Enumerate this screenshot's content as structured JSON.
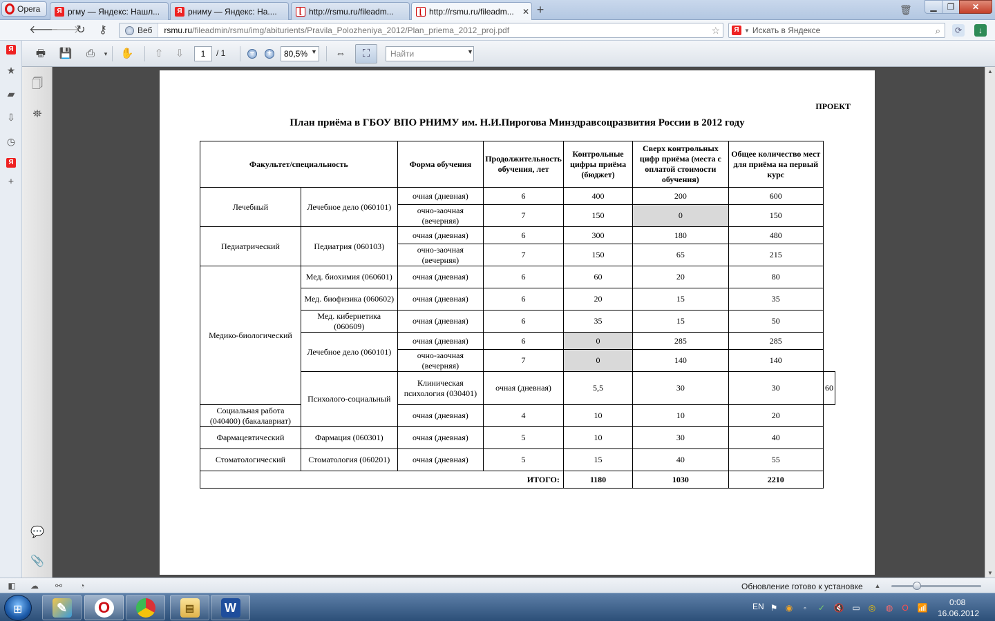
{
  "browser": {
    "menu_label": "Opera",
    "tabs": [
      {
        "title": "ргму — Яндекс: Нашл...",
        "icon": "yandex-icon"
      },
      {
        "title": "рниму — Яндекс: На....",
        "icon": "yandex-icon"
      },
      {
        "title": "http://rsmu.ru/fileadm...",
        "icon": "pdf-icon"
      },
      {
        "title": "http://rsmu.ru/fileadm...",
        "icon": "pdf-icon"
      }
    ],
    "new_tab": "+",
    "address": {
      "mode_label": "Веб",
      "url_domain": "rsmu.ru",
      "url_path": "/fileadmin/rsmu/img/abiturients/Pravila_Polozheniya_2012/Plan_priema_2012_proj.pdf"
    },
    "search": {
      "engine_badge": "Я",
      "placeholder": "Искать в Яндексе"
    }
  },
  "pdf_toolbar": {
    "page_current": "1",
    "page_total": "/ 1",
    "zoom": "80,5%",
    "find_placeholder": "Найти"
  },
  "document": {
    "stamp": "ПРОЕКТ",
    "title": "План приёма в ГБОУ ВПО РНИМУ им. Н.И.Пирогова Минздравсоцразвития России в 2012 году",
    "headers": {
      "faculty": "Факультет/специальность",
      "form": "Форма обучения",
      "duration": "Продолжительность обучения, лет",
      "budget": "Контрольные цифры приёма (бюджет)",
      "paid": "Сверх контрольных цифр приёма (места с оплатой стоимости обучения)",
      "total": "Общее количество мест для приёма на первый курс"
    },
    "faculties": {
      "lech": "Лечебный",
      "ped": "Педиатрический",
      "medbio": "Медико-биологический",
      "psy": "Психолого-социальный",
      "farm": "Фармацевтический",
      "stom": "Стоматологический"
    },
    "specialties": {
      "lech_delo": "Лечебное дело (060101)",
      "pediatriya": "Педиатрия (060103)",
      "biochem": "Мед. биохимия (060601)",
      "biophys": "Мед. биофизика (060602)",
      "cyber": "Мед. кибернетика (060609)",
      "lech_delo2": "Лечебное дело (060101)",
      "clinpsy": "Клиническая психология (030401)",
      "social": "Социальная работа (040400) (бакалавриат)",
      "farmaciya": "Фармация (060301)",
      "stomat": "Стоматология (060201)"
    },
    "forms": {
      "day": "очная (дневная)",
      "evening": "очно-заочная (вечерняя)"
    },
    "rows": [
      {
        "duration": "6",
        "budget": "400",
        "paid": "200",
        "total": "600"
      },
      {
        "duration": "7",
        "budget": "150",
        "paid": "0",
        "total": "150"
      },
      {
        "duration": "6",
        "budget": "300",
        "paid": "180",
        "total": "480"
      },
      {
        "duration": "7",
        "budget": "150",
        "paid": "65",
        "total": "215"
      },
      {
        "duration": "6",
        "budget": "60",
        "paid": "20",
        "total": "80"
      },
      {
        "duration": "6",
        "budget": "20",
        "paid": "15",
        "total": "35"
      },
      {
        "duration": "6",
        "budget": "35",
        "paid": "15",
        "total": "50"
      },
      {
        "duration": "6",
        "budget": "0",
        "paid": "285",
        "total": "285"
      },
      {
        "duration": "7",
        "budget": "0",
        "paid": "140",
        "total": "140"
      },
      {
        "duration": "5,5",
        "budget": "30",
        "paid": "30",
        "total": "60"
      },
      {
        "duration": "4",
        "budget": "10",
        "paid": "10",
        "total": "20"
      },
      {
        "duration": "5",
        "budget": "10",
        "paid": "30",
        "total": "40"
      },
      {
        "duration": "5",
        "budget": "15",
        "paid": "40",
        "total": "55"
      }
    ],
    "totals": {
      "label": "ИТОГО:",
      "budget": "1180",
      "paid": "1030",
      "total": "2210"
    }
  },
  "status_bar": {
    "message": "Обновление готово к установке"
  },
  "taskbar": {
    "language": "EN",
    "time": "0:08",
    "date": "16.06.2012",
    "apps": [
      "paint-icon",
      "opera-icon",
      "chrome-icon",
      "explorer-icon",
      "word-icon"
    ]
  },
  "colors": {
    "accent": "#cc0f16",
    "gray_cell": "#d9d9d9",
    "canvas": "#4a4a4a"
  }
}
